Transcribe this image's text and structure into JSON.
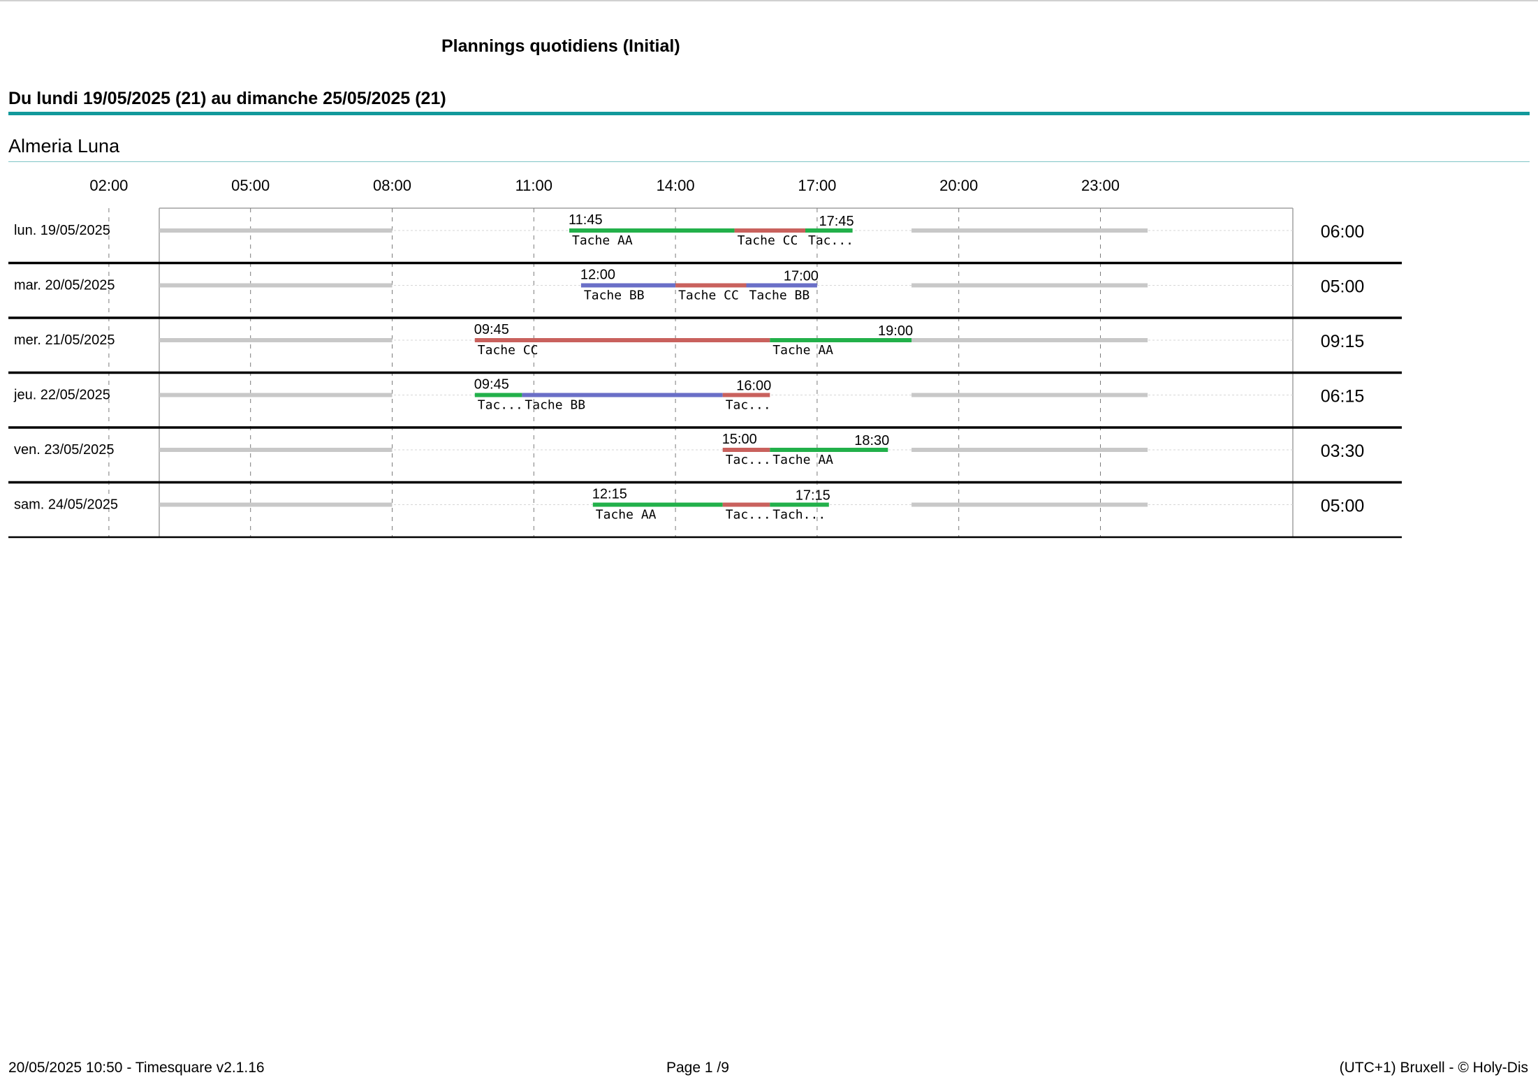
{
  "report": {
    "title": "Plannings quotidiens (Initial)",
    "period": "Du lundi 19/05/2025 (21) au dimanche 25/05/2025 (21)",
    "person": "Almeria Luna"
  },
  "chart_data": {
    "type": "gantt",
    "x_range": [
      "00:00",
      "24:00"
    ],
    "axis_ticks": [
      "02:00",
      "05:00",
      "08:00",
      "11:00",
      "14:00",
      "17:00",
      "20:00",
      "23:00"
    ],
    "task_colors": {
      "Tache AA": "#22b04a",
      "Tache BB": "#6a6fc7",
      "Tache CC": "#c9615d",
      "unavailable": "#c8c8c8"
    },
    "unavailable_ranges": [
      [
        "00:00",
        "08:00"
      ],
      [
        "19:00",
        "24:00"
      ]
    ],
    "rows": [
      {
        "date": "lun. 19/05/2025",
        "start_label": "11:45",
        "end_label": "17:45",
        "total": "06:00",
        "segments": [
          {
            "task": "Tache AA",
            "start": "11:45",
            "end": "15:15",
            "label": "Tache AA"
          },
          {
            "task": "Tache CC",
            "start": "15:15",
            "end": "16:45",
            "label": "Tache CC"
          },
          {
            "task": "Tache AA",
            "start": "16:45",
            "end": "17:45",
            "label": "Tac..."
          }
        ]
      },
      {
        "date": "mar. 20/05/2025",
        "start_label": "12:00",
        "end_label": "17:00",
        "total": "05:00",
        "segments": [
          {
            "task": "Tache BB",
            "start": "12:00",
            "end": "14:00",
            "label": "Tache BB"
          },
          {
            "task": "Tache CC",
            "start": "14:00",
            "end": "15:30",
            "label": "Tache CC"
          },
          {
            "task": "Tache BB",
            "start": "15:30",
            "end": "17:00",
            "label": "Tache BB"
          }
        ]
      },
      {
        "date": "mer. 21/05/2025",
        "start_label": "09:45",
        "end_label": "19:00",
        "total": "09:15",
        "segments": [
          {
            "task": "Tache CC",
            "start": "09:45",
            "end": "16:00",
            "label": "Tache CC"
          },
          {
            "task": "Tache AA",
            "start": "16:00",
            "end": "19:00",
            "label": "Tache AA"
          }
        ]
      },
      {
        "date": "jeu. 22/05/2025",
        "start_label": "09:45",
        "end_label": "16:00",
        "total": "06:15",
        "segments": [
          {
            "task": "Tache AA",
            "start": "09:45",
            "end": "10:45",
            "label": "Tac..."
          },
          {
            "task": "Tache BB",
            "start": "10:45",
            "end": "15:00",
            "label": "Tache BB"
          },
          {
            "task": "Tache CC",
            "start": "15:00",
            "end": "16:00",
            "label": "Tac..."
          }
        ]
      },
      {
        "date": "ven. 23/05/2025",
        "start_label": "15:00",
        "end_label": "18:30",
        "total": "03:30",
        "segments": [
          {
            "task": "Tache CC",
            "start": "15:00",
            "end": "16:00",
            "label": "Tac..."
          },
          {
            "task": "Tache AA",
            "start": "16:00",
            "end": "18:30",
            "label": "Tache AA"
          }
        ]
      },
      {
        "date": "sam. 24/05/2025",
        "start_label": "12:15",
        "end_label": "17:15",
        "total": "05:00",
        "segments": [
          {
            "task": "Tache AA",
            "start": "12:15",
            "end": "15:00",
            "label": "Tache AA"
          },
          {
            "task": "Tache CC",
            "start": "15:00",
            "end": "16:00",
            "label": "Tac..."
          },
          {
            "task": "Tache AA",
            "start": "16:00",
            "end": "17:15",
            "label": "Tach..."
          }
        ]
      }
    ]
  },
  "footer": {
    "left": "20/05/2025 10:50 - Timesquare v2.1.16",
    "center": "Page 1 /9",
    "right": "(UTC+1) Bruxell - © Holy-Dis"
  }
}
